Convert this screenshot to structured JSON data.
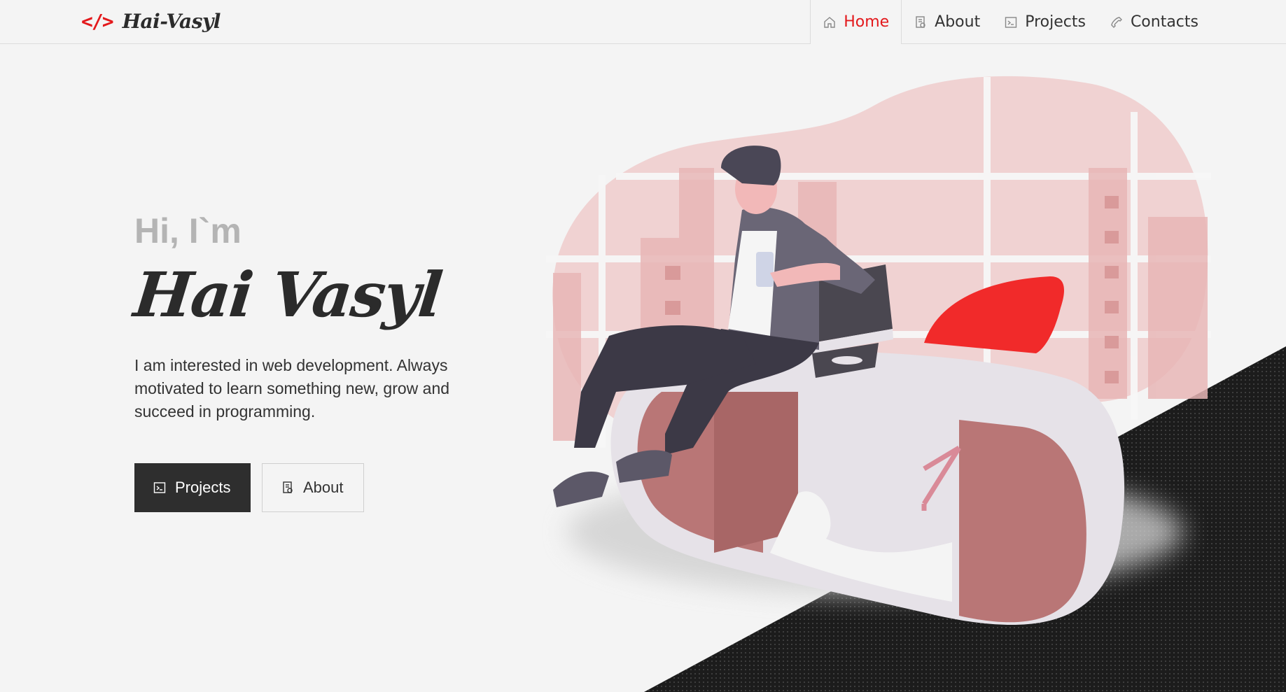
{
  "header": {
    "logo_mark": "</>",
    "logo_text": "Hai-Vasyl",
    "nav": [
      {
        "label": "Home",
        "icon": "home-icon",
        "active": true
      },
      {
        "label": "About",
        "icon": "document-icon",
        "active": false
      },
      {
        "label": "Projects",
        "icon": "terminal-icon",
        "active": false
      },
      {
        "label": "Contacts",
        "icon": "phone-icon",
        "active": false
      }
    ]
  },
  "hero": {
    "greeting": "Hi, I`m",
    "name": "Hai Vasyl",
    "description": "I am interested in web development. Always motivated to learn something new, grow and succeed in programming.",
    "buttons": {
      "projects": "Projects",
      "about": "About"
    }
  },
  "colors": {
    "accent": "#e3191c",
    "dark": "#2e2e2e",
    "background": "#f4f4f4"
  }
}
